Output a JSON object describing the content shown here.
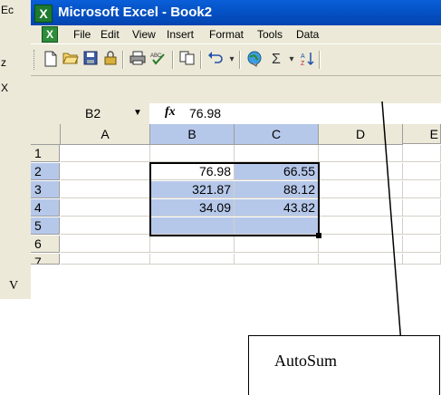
{
  "left_fragments": [
    "Ec",
    "z",
    "X"
  ],
  "left_fragment_bottom": "V",
  "window": {
    "title": "Microsoft Excel - Book2"
  },
  "menu": [
    {
      "label": "File",
      "id": "file"
    },
    {
      "label": "Edit",
      "id": "edit"
    },
    {
      "label": "View",
      "id": "view"
    },
    {
      "label": "Insert",
      "id": "insert"
    },
    {
      "label": "Format",
      "id": "format"
    },
    {
      "label": "Tools",
      "id": "tools"
    },
    {
      "label": "Data",
      "id": "data"
    }
  ],
  "toolbar": [
    {
      "name": "new-document-icon",
      "glyph": "🗋"
    },
    {
      "name": "open-folder-icon",
      "glyph": "📂"
    },
    {
      "name": "save-icon",
      "glyph": "💾"
    },
    {
      "name": "permission-icon",
      "glyph": "🔒"
    },
    {
      "name": "print-icon",
      "glyph": "🖶"
    },
    {
      "name": "spelling-icon",
      "glyph": "✓"
    },
    {
      "name": "copy-icon",
      "glyph": "⎘"
    },
    {
      "name": "undo-icon",
      "glyph": "↶"
    },
    {
      "name": "undo-dropdown-icon",
      "glyph": "▾"
    },
    {
      "name": "hyperlink-icon",
      "glyph": "🌐"
    },
    {
      "name": "autosum-icon",
      "glyph": "Σ"
    },
    {
      "name": "autosum-dropdown-icon",
      "glyph": "▾"
    },
    {
      "name": "sort-ascending-icon",
      "glyph": "A↓"
    }
  ],
  "name_box": {
    "value": "B2"
  },
  "formula_bar": {
    "fx": "fx",
    "value": "76.98"
  },
  "columns": [
    "A",
    "B",
    "C",
    "D",
    "E"
  ],
  "rows": [
    "1",
    "2",
    "3",
    "4",
    "5",
    "6",
    "7"
  ],
  "cells": {
    "B2": "76.98",
    "C2": "66.55",
    "B3": "321.87",
    "C3": "88.12",
    "B4": "34.09",
    "C4": "43.82"
  },
  "callout": {
    "label": "AutoSum"
  },
  "colors": {
    "title_bar": "#0553c8",
    "selection": "#b6c8ea",
    "chrome": "#ece9d8"
  }
}
